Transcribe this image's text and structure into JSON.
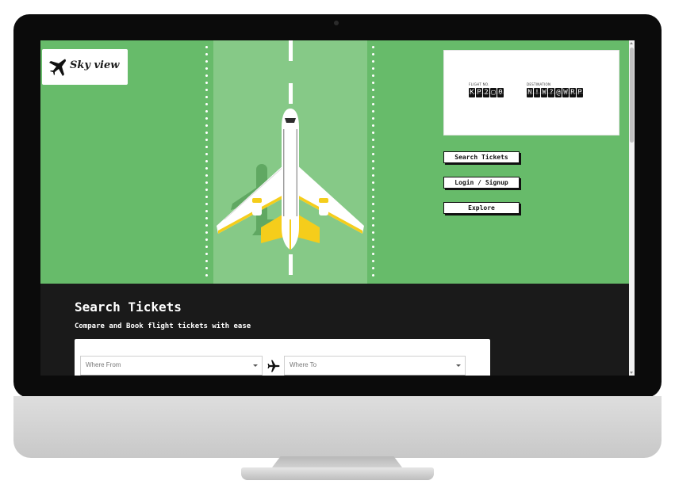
{
  "brand": {
    "name": "Sky view",
    "icon": "airplane-icon"
  },
  "flight_board": {
    "flight_label": "FLIGHT NO.",
    "flight_value": "KP2▢0",
    "destination_label": "DESTINATION",
    "destination_value": "N!W?@WRP"
  },
  "actions": {
    "search_label": "Search Tickets",
    "login_label": "Login / Signup",
    "explore_label": "Explore"
  },
  "search": {
    "title": "Search Tickets",
    "subtitle": "Compare and Book flight tickets with ease",
    "from_placeholder": "Where From",
    "to_placeholder": "Where To",
    "swap_icon": "airplane-icon"
  },
  "colors": {
    "hero_green": "#67bb6a",
    "runway_green": "#86c987",
    "plane_accent": "#f5cd1b",
    "dark_section": "#1a1a1a"
  }
}
